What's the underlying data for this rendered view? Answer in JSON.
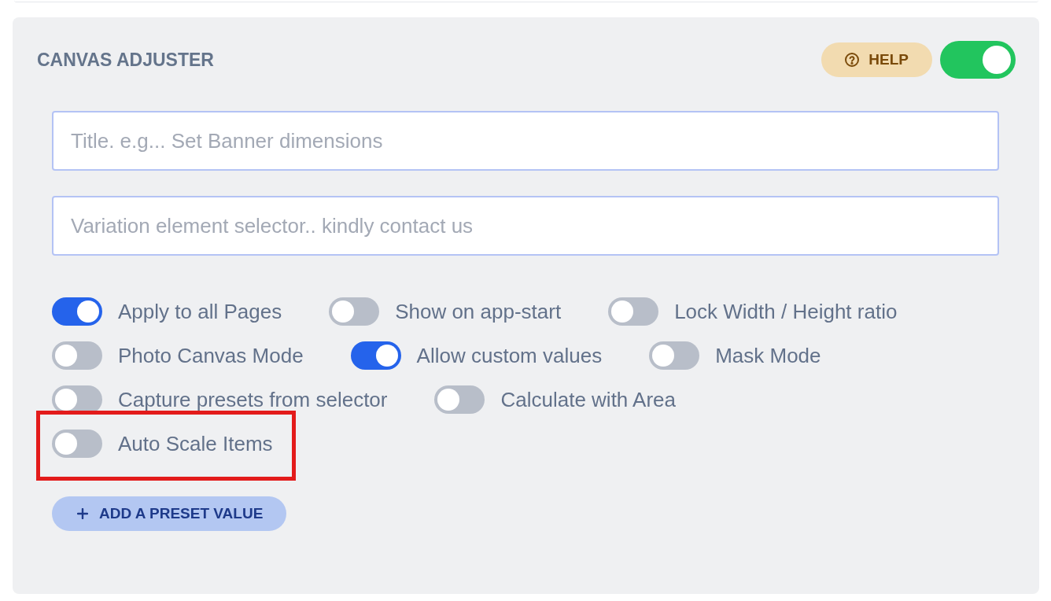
{
  "panel": {
    "title": "CANVAS ADJUSTER",
    "help_button": {
      "label": "HELP"
    },
    "enabled": true
  },
  "fields": [
    {
      "placeholder": "Title. e.g... Set Banner dimensions"
    },
    {
      "placeholder": "Variation element selector.. kindly contact us"
    }
  ],
  "options": [
    {
      "label": "Apply to all Pages",
      "on": true,
      "highlighted": false
    },
    {
      "label": "Show on app-start",
      "on": false,
      "highlighted": false
    },
    {
      "label": "Lock Width / Height ratio",
      "on": false,
      "highlighted": false
    },
    {
      "label": "Photo Canvas Mode",
      "on": false,
      "highlighted": false
    },
    {
      "label": "Allow custom values",
      "on": true,
      "highlighted": false
    },
    {
      "label": "Mask Mode",
      "on": false,
      "highlighted": false
    },
    {
      "label": "Capture presets from selector",
      "on": false,
      "highlighted": false
    },
    {
      "label": "Calculate with Area",
      "on": false,
      "highlighted": false
    },
    {
      "label": "Auto Scale Items",
      "on": false,
      "highlighted": true
    }
  ],
  "add_button": {
    "label": "ADD A PRESET VALUE"
  }
}
